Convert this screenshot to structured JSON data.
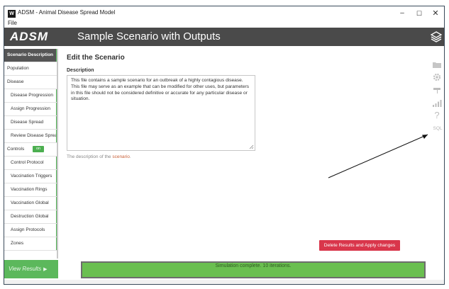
{
  "window": {
    "icon_label": "W",
    "title": "ADSM - Animal Disease Spread Model",
    "minimize": "–",
    "maximize": "☐",
    "close": "✕"
  },
  "menu": {
    "file": "File"
  },
  "header": {
    "brand": "ADSM",
    "scenario_title": "Sample Scenario with Outputs"
  },
  "sidebar": {
    "items": [
      {
        "label": "Scenario Description",
        "active": true
      },
      {
        "label": "Population"
      },
      {
        "label": "Disease"
      },
      {
        "label": "Disease Progression"
      },
      {
        "label": "Assign Progression"
      },
      {
        "label": "Disease Spread"
      },
      {
        "label": "Review Disease Spread"
      },
      {
        "label": "Controls"
      },
      {
        "label": "Control Protocol"
      },
      {
        "label": "Vaccination Triggers"
      },
      {
        "label": "Vaccination Rings"
      },
      {
        "label": "Vaccination Global"
      },
      {
        "label": "Destruction Global"
      },
      {
        "label": "Assign Protocols"
      },
      {
        "label": "Zones"
      }
    ],
    "controls_toggle": "on",
    "view_results": "View Results",
    "view_results_arrow": "▶"
  },
  "main": {
    "heading": "Edit the Scenario",
    "description_label": "Description",
    "description_value": "This file contains a sample scenario for an outbreak of a highly contagious disease. This file may serve as an example that can be modified for other uses, but parameters in this file should not be considered definitive or accurate for any particular disease or situation.",
    "help_prefix": "The description of the ",
    "help_link": "scenario",
    "help_suffix": "."
  },
  "toolbar": {
    "icons": [
      "folder-icon",
      "gear-icon",
      "flag-icon",
      "signal-icon",
      "help-icon",
      "sql-icon"
    ],
    "help_glyph": "?",
    "sql_label": "SQL"
  },
  "actions": {
    "delete_results": "Delete Results and Apply changes"
  },
  "status": {
    "text": "Simulation complete. 10 iterations."
  },
  "colors": {
    "header_bg": "#4a4a4a",
    "accent_green": "#4caf50",
    "status_green": "#6abf50",
    "delete_red": "#d9364b",
    "link_orange": "#c9623a"
  }
}
